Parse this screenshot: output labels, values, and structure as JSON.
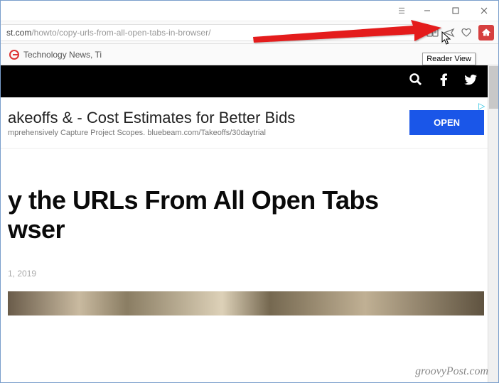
{
  "url_prefix": "st.com",
  "url_path": "/howto/copy-urls-from-all-open-tabs-in-browser/",
  "bookmark": "Technology News, Ti",
  "tooltip": "Reader View",
  "ad": {
    "title": "akeoffs & - Cost Estimates for Better Bids",
    "desc": "mprehensively Capture Project Scopes. bluebeam.com/Takeoffs/30daytrial",
    "button": "OPEN"
  },
  "article": {
    "title_line1": "y the URLs From All Open Tabs",
    "title_line2": "wser",
    "date": "1, 2019"
  },
  "watermark": "groovyPost.com"
}
